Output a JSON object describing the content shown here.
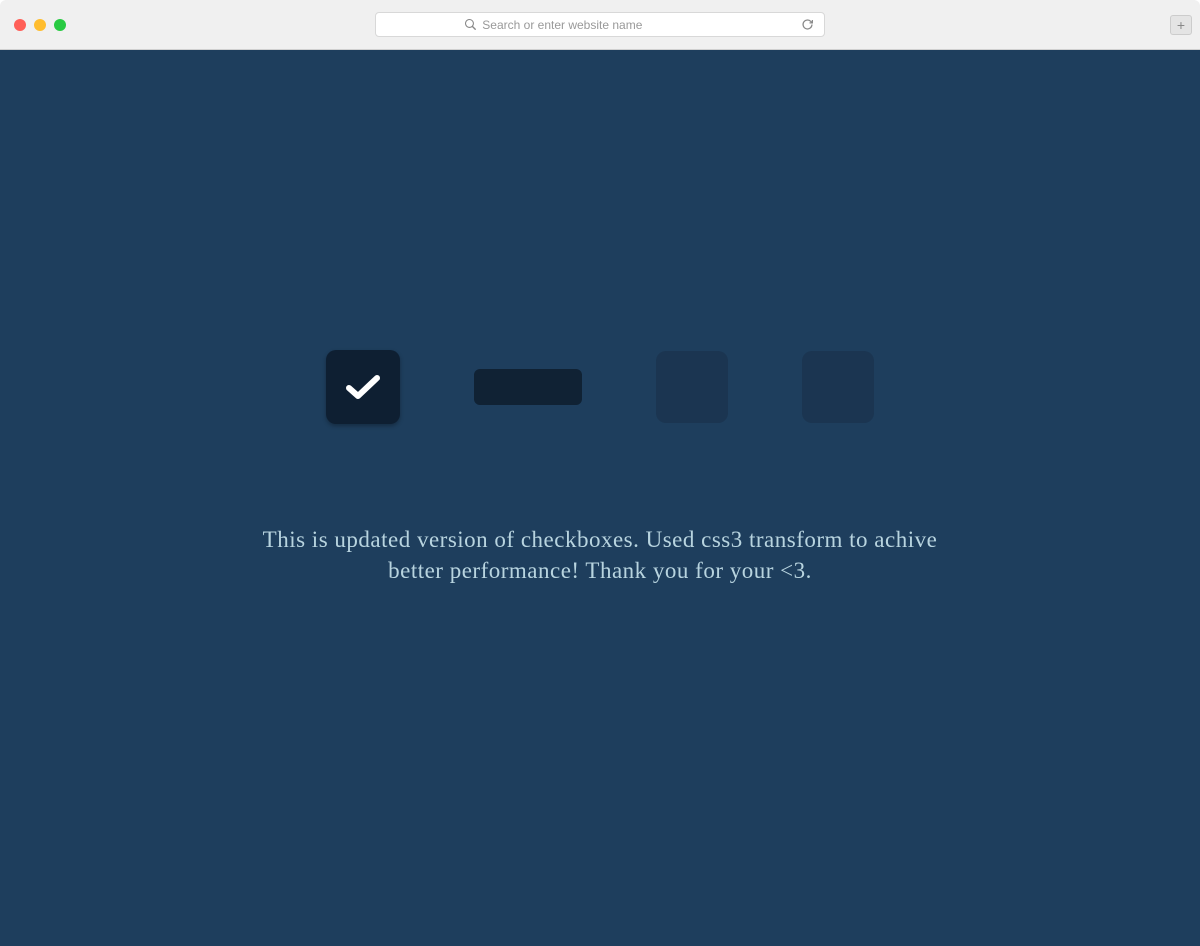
{
  "browser": {
    "address_placeholder": "Search or enter website name",
    "new_tab_label": "+"
  },
  "content": {
    "checkboxes": [
      {
        "state": "checked"
      },
      {
        "state": "flat"
      },
      {
        "state": "unchecked"
      },
      {
        "state": "unchecked"
      }
    ],
    "description": "This is updated version of checkboxes. Used css3 transform to achive better performance! Thank you for your <3."
  },
  "colors": {
    "page_bg": "#1e3e5d",
    "checkbox_checked_bg": "#0e1f32",
    "checkbox_flat_bg": "#102234",
    "checkbox_unchecked_bg": "#1b3551",
    "text_color": "#b8d4df"
  }
}
